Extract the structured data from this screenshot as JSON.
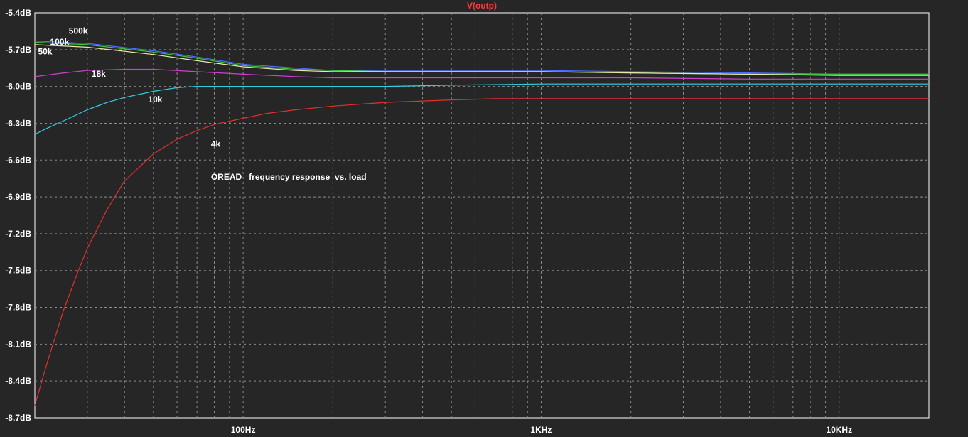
{
  "chart_data": {
    "type": "line",
    "title": "V(outp)",
    "annotation": "OREAD   frequency response  vs. load",
    "x_scale": "log",
    "xlim": [
      20,
      20000
    ],
    "ylim": [
      -8.7,
      -5.4
    ],
    "grid": true,
    "x_ticks": [
      {
        "value": 100,
        "label": "100Hz"
      },
      {
        "value": 1000,
        "label": "1KHz"
      },
      {
        "value": 10000,
        "label": "10KHz"
      }
    ],
    "y_ticks": [
      {
        "value": -5.4,
        "label": "-5.4dB"
      },
      {
        "value": -5.7,
        "label": "-5.7dB"
      },
      {
        "value": -6.0,
        "label": "-6.0dB"
      },
      {
        "value": -6.3,
        "label": "-6.3dB"
      },
      {
        "value": -6.6,
        "label": "-6.6dB"
      },
      {
        "value": -6.9,
        "label": "-6.9dB"
      },
      {
        "value": -7.2,
        "label": "-7.2dB"
      },
      {
        "value": -7.5,
        "label": "-7.5dB"
      },
      {
        "value": -7.8,
        "label": "-7.8dB"
      },
      {
        "value": -8.1,
        "label": "-8.1dB"
      },
      {
        "value": -8.4,
        "label": "-8.4dB"
      },
      {
        "value": -8.7,
        "label": "-8.7dB"
      }
    ],
    "series": [
      {
        "name": "500k",
        "color": "#4a6cff",
        "x": [
          20,
          30,
          50,
          70,
          100,
          150,
          200,
          300,
          500,
          1000,
          2000,
          5000,
          10000,
          20000
        ],
        "y": [
          -5.63,
          -5.65,
          -5.71,
          -5.76,
          -5.82,
          -5.85,
          -5.87,
          -5.87,
          -5.87,
          -5.87,
          -5.88,
          -5.89,
          -5.9,
          -5.9
        ]
      },
      {
        "name": "100k",
        "color": "#3cc83c",
        "x": [
          20,
          30,
          50,
          70,
          100,
          150,
          200,
          300,
          500,
          1000,
          2000,
          5000,
          10000,
          20000
        ],
        "y": [
          -5.64,
          -5.66,
          -5.72,
          -5.77,
          -5.83,
          -5.86,
          -5.87,
          -5.88,
          -5.88,
          -5.88,
          -5.89,
          -5.9,
          -5.9,
          -5.9
        ]
      },
      {
        "name": "50k",
        "color": "#e8e8a8",
        "x": [
          20,
          30,
          50,
          70,
          100,
          150,
          200,
          300,
          500,
          1000,
          2000,
          5000,
          10000,
          20000
        ],
        "y": [
          -5.66,
          -5.68,
          -5.74,
          -5.79,
          -5.84,
          -5.87,
          -5.88,
          -5.88,
          -5.88,
          -5.88,
          -5.89,
          -5.9,
          -5.91,
          -5.91
        ]
      },
      {
        "name": "18k",
        "color": "#d040d0",
        "x": [
          20,
          25,
          30,
          40,
          50,
          70,
          100,
          150,
          200,
          300,
          500,
          1000,
          2000,
          5000,
          10000,
          20000
        ],
        "y": [
          -5.92,
          -5.89,
          -5.87,
          -5.86,
          -5.86,
          -5.88,
          -5.9,
          -5.92,
          -5.93,
          -5.93,
          -5.93,
          -5.93,
          -5.93,
          -5.94,
          -5.94,
          -5.94
        ]
      },
      {
        "name": "10k",
        "color": "#30d0e0",
        "x": [
          20,
          22,
          25,
          30,
          35,
          40,
          50,
          60,
          70,
          100,
          150,
          200,
          300,
          500,
          1000,
          2000,
          5000,
          10000,
          20000
        ],
        "y": [
          -6.39,
          -6.34,
          -6.28,
          -6.19,
          -6.13,
          -6.09,
          -6.04,
          -6.01,
          -6.0,
          -6.0,
          -6.0,
          -6.0,
          -6.0,
          -5.99,
          -5.98,
          -5.98,
          -5.98,
          -5.98,
          -5.98
        ]
      },
      {
        "name": "4k",
        "color": "#e03030",
        "x": [
          20,
          22,
          25,
          28,
          30,
          35,
          40,
          50,
          60,
          70,
          80,
          100,
          120,
          150,
          200,
          300,
          500,
          700,
          1000,
          2000,
          5000,
          10000,
          20000
        ],
        "y": [
          -8.6,
          -8.25,
          -7.82,
          -7.5,
          -7.32,
          -7.0,
          -6.77,
          -6.55,
          -6.43,
          -6.36,
          -6.31,
          -6.26,
          -6.22,
          -6.19,
          -6.16,
          -6.13,
          -6.11,
          -6.1,
          -6.1,
          -6.1,
          -6.1,
          -6.1,
          -6.1
        ]
      }
    ],
    "curve_labels": [
      {
        "text": "500k",
        "x": 26,
        "y": -5.57
      },
      {
        "text": "100k",
        "x": 22.5,
        "y": -5.66
      },
      {
        "text": "50k",
        "x": 20.5,
        "y": -5.74
      },
      {
        "text": "18k",
        "x": 31,
        "y": -5.92
      },
      {
        "text": "10k",
        "x": 48,
        "y": -6.13
      },
      {
        "text": "4k",
        "x": 78,
        "y": -6.49
      }
    ],
    "annotation_pos": {
      "x": 78,
      "y": -6.76
    }
  }
}
